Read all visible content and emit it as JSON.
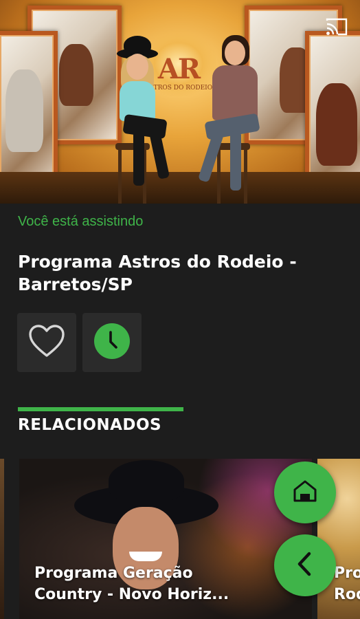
{
  "player": {
    "cast_icon": "cast-icon",
    "logo_text": "AR",
    "logo_subtext": "ASTROS DO RODEIO"
  },
  "info": {
    "watching_label": "Você está assistindo",
    "title": "Programa Astros do Rodeio - Barretos/SP"
  },
  "actions": [
    {
      "icon": "heart-outline-icon"
    },
    {
      "icon": "clock-icon"
    }
  ],
  "related": {
    "section_title": "RELACIONADOS",
    "items": [
      {
        "title": "Programa Geração\nCountry - Novo Horiz..."
      },
      {
        "title": "Pro\nRod"
      }
    ]
  },
  "fabs": [
    {
      "icon": "home-icon"
    },
    {
      "icon": "back-arrow-icon"
    }
  ],
  "colors": {
    "accent": "#3fb449",
    "background": "#1d1d1d",
    "button_bg": "#2b2b2b"
  }
}
